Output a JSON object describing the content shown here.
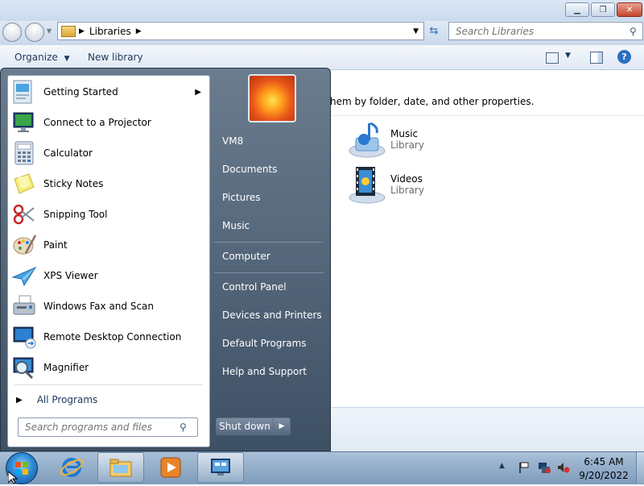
{
  "address": {
    "crumb": "Libraries"
  },
  "search": {
    "placeholder": "Search Libraries"
  },
  "toolbar": {
    "organize": "Organize",
    "new_library": "New library"
  },
  "content": {
    "description_partial": "hem by folder, date, and other properties.",
    "libraries": [
      {
        "name": "Music",
        "type": "Library"
      },
      {
        "name": "Videos",
        "type": "Library"
      }
    ]
  },
  "start_menu": {
    "programs": [
      {
        "label": "Getting Started",
        "icon": "getting-started-icon"
      },
      {
        "label": "Connect to a Projector",
        "icon": "projector-icon"
      },
      {
        "label": "Calculator",
        "icon": "calculator-icon"
      },
      {
        "label": "Sticky Notes",
        "icon": "sticky-notes-icon"
      },
      {
        "label": "Snipping Tool",
        "icon": "snipping-tool-icon"
      },
      {
        "label": "Paint",
        "icon": "paint-icon"
      },
      {
        "label": "XPS Viewer",
        "icon": "xps-viewer-icon"
      },
      {
        "label": "Windows Fax and Scan",
        "icon": "fax-scan-icon"
      },
      {
        "label": "Remote Desktop Connection",
        "icon": "remote-desktop-icon"
      },
      {
        "label": "Magnifier",
        "icon": "magnifier-icon"
      }
    ],
    "all_programs": "All Programs",
    "search_placeholder": "Search programs and files",
    "right": {
      "user": "VM8",
      "documents": "Documents",
      "pictures": "Pictures",
      "music": "Music",
      "computer": "Computer",
      "control_panel": "Control Panel",
      "devices": "Devices and Printers",
      "default_programs": "Default Programs",
      "help": "Help and Support"
    },
    "shutdown": "Shut down"
  },
  "taskbar": {
    "time": "6:45 AM",
    "date": "9/20/2022"
  },
  "colors": {
    "start_menu_bg": "#4f6176",
    "taskbar": "#8eabc8",
    "accent": "#1e395b"
  }
}
